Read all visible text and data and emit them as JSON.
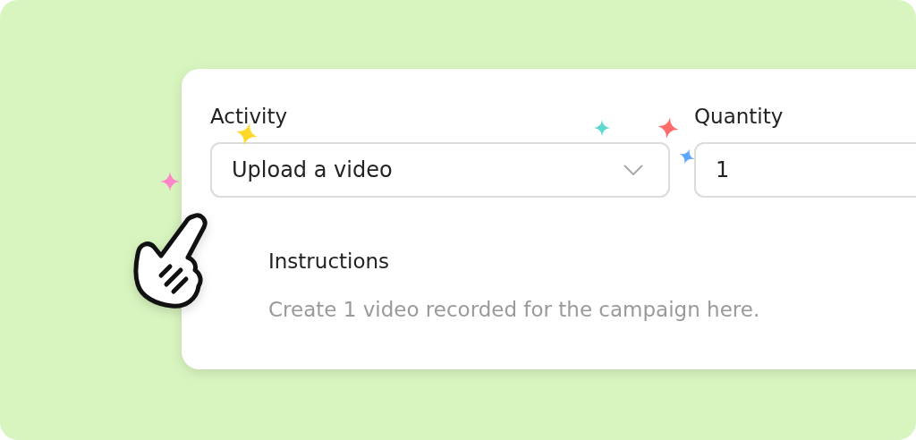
{
  "activity": {
    "label": "Activity",
    "value": "Upload a video"
  },
  "quantity": {
    "label": "Quantity",
    "value": "1"
  },
  "instructions": {
    "label": "Instructions",
    "placeholder": "Create 1 video recorded for the campaign here."
  }
}
